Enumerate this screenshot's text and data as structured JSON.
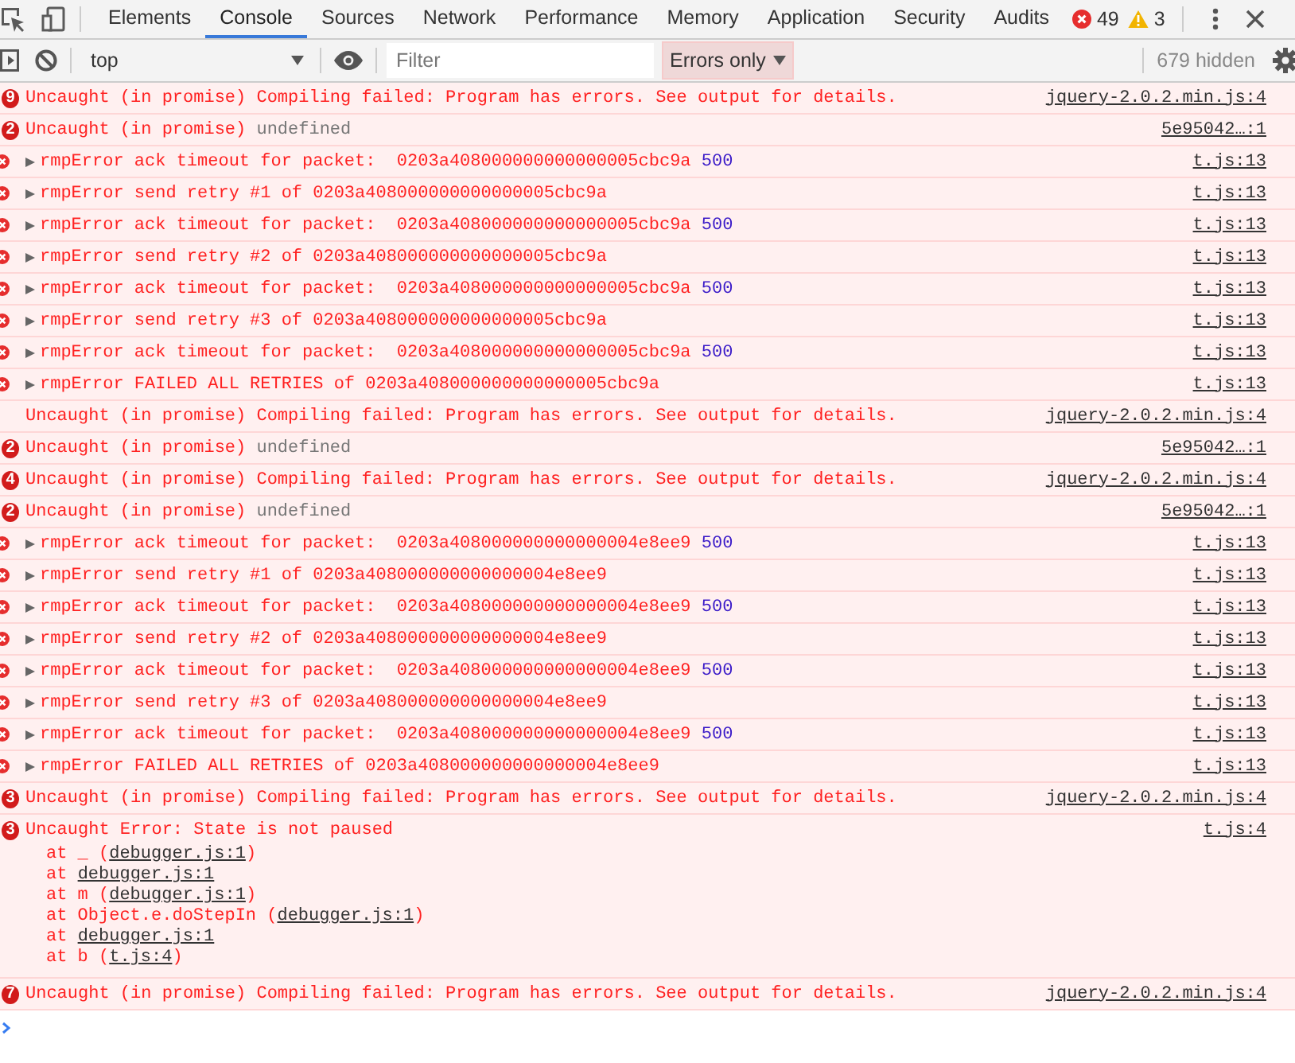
{
  "tabs": [
    {
      "label": "Elements",
      "selected": false
    },
    {
      "label": "Console",
      "selected": true
    },
    {
      "label": "Sources",
      "selected": false
    },
    {
      "label": "Network",
      "selected": false
    },
    {
      "label": "Performance",
      "selected": false
    },
    {
      "label": "Memory",
      "selected": false
    },
    {
      "label": "Application",
      "selected": false
    },
    {
      "label": "Security",
      "selected": false
    },
    {
      "label": "Audits",
      "selected": false
    }
  ],
  "counters": {
    "errors": "49",
    "warnings": "3"
  },
  "toolbar": {
    "context": "top",
    "filter": {
      "placeholder": "Filter"
    },
    "level": "Errors only",
    "hidden": "679 hidden"
  },
  "messages": [
    {
      "kind": "group",
      "count": "9",
      "text": "Uncaught (in promise) Compiling failed: Program has errors. See output for details.",
      "source": "jquery-2.0.2.min.js:4"
    },
    {
      "kind": "group",
      "count": "2",
      "text": "Uncaught (in promise)",
      "detail": "undefined",
      "source": "5e95042…:1"
    },
    {
      "kind": "error",
      "expanded": false,
      "text": "rmpError ack timeout for packet:  0203a408000000000000005cbc9a",
      "number": "500",
      "source": "t.js:13"
    },
    {
      "kind": "error",
      "expanded": false,
      "text": "rmpError send retry #1 of 0203a408000000000000005cbc9a",
      "source": "t.js:13"
    },
    {
      "kind": "error",
      "expanded": false,
      "text": "rmpError ack timeout for packet:  0203a408000000000000005cbc9a",
      "number": "500",
      "source": "t.js:13"
    },
    {
      "kind": "error",
      "expanded": false,
      "text": "rmpError send retry #2 of 0203a408000000000000005cbc9a",
      "source": "t.js:13"
    },
    {
      "kind": "error",
      "expanded": false,
      "text": "rmpError ack timeout for packet:  0203a408000000000000005cbc9a",
      "number": "500",
      "source": "t.js:13"
    },
    {
      "kind": "error",
      "expanded": false,
      "text": "rmpError send retry #3 of 0203a408000000000000005cbc9a",
      "source": "t.js:13"
    },
    {
      "kind": "error",
      "expanded": false,
      "text": "rmpError ack timeout for packet:  0203a408000000000000005cbc9a",
      "number": "500",
      "source": "t.js:13"
    },
    {
      "kind": "error",
      "expanded": false,
      "text": "rmpError FAILED ALL RETRIES of 0203a408000000000000005cbc9a",
      "source": "t.js:13"
    },
    {
      "kind": "plain",
      "text": "Uncaught (in promise) Compiling failed: Program has errors. See output for details.",
      "source": "jquery-2.0.2.min.js:4"
    },
    {
      "kind": "group",
      "count": "2",
      "text": "Uncaught (in promise)",
      "detail": "undefined",
      "source": "5e95042…:1"
    },
    {
      "kind": "group",
      "count": "4",
      "text": "Uncaught (in promise) Compiling failed: Program has errors. See output for details.",
      "source": "jquery-2.0.2.min.js:4"
    },
    {
      "kind": "group",
      "count": "2",
      "text": "Uncaught (in promise)",
      "detail": "undefined",
      "source": "5e95042…:1"
    },
    {
      "kind": "error",
      "expanded": false,
      "text": "rmpError ack timeout for packet:  0203a408000000000000004e8ee9",
      "number": "500",
      "source": "t.js:13"
    },
    {
      "kind": "error",
      "expanded": false,
      "text": "rmpError send retry #1 of 0203a408000000000000004e8ee9",
      "source": "t.js:13"
    },
    {
      "kind": "error",
      "expanded": false,
      "text": "rmpError ack timeout for packet:  0203a408000000000000004e8ee9",
      "number": "500",
      "source": "t.js:13"
    },
    {
      "kind": "error",
      "expanded": false,
      "text": "rmpError send retry #2 of 0203a408000000000000004e8ee9",
      "source": "t.js:13"
    },
    {
      "kind": "error",
      "expanded": false,
      "text": "rmpError ack timeout for packet:  0203a408000000000000004e8ee9",
      "number": "500",
      "source": "t.js:13"
    },
    {
      "kind": "error",
      "expanded": false,
      "text": "rmpError send retry #3 of 0203a408000000000000004e8ee9",
      "source": "t.js:13"
    },
    {
      "kind": "error",
      "expanded": false,
      "text": "rmpError ack timeout for packet:  0203a408000000000000004e8ee9",
      "number": "500",
      "source": "t.js:13"
    },
    {
      "kind": "error",
      "expanded": false,
      "text": "rmpError FAILED ALL RETRIES of 0203a408000000000000004e8ee9",
      "source": "t.js:13"
    },
    {
      "kind": "group",
      "count": "3",
      "text": "Uncaught (in promise) Compiling failed: Program has errors. See output for details.",
      "source": "jquery-2.0.2.min.js:4"
    },
    {
      "kind": "group",
      "count": "3",
      "text": "Uncaught Error: State is not paused",
      "source": "t.js:4",
      "stack": [
        {
          "prefix": "at _ (",
          "link": "debugger.js:1",
          "suffix": ")"
        },
        {
          "prefix": "at ",
          "link": "debugger.js:1"
        },
        {
          "prefix": "at m (",
          "link": "debugger.js:1",
          "suffix": ")"
        },
        {
          "prefix": "at Object.e.doStepIn (",
          "link": "debugger.js:1",
          "suffix": ")"
        },
        {
          "prefix": "at ",
          "link": "debugger.js:1"
        },
        {
          "prefix": "at b (",
          "link": "t.js:4",
          "suffix": ")"
        }
      ]
    },
    {
      "kind": "group",
      "count": "7",
      "text": "Uncaught (in promise) Compiling failed: Program has errors. See output for details.",
      "source": "jquery-2.0.2.min.js:4"
    }
  ]
}
